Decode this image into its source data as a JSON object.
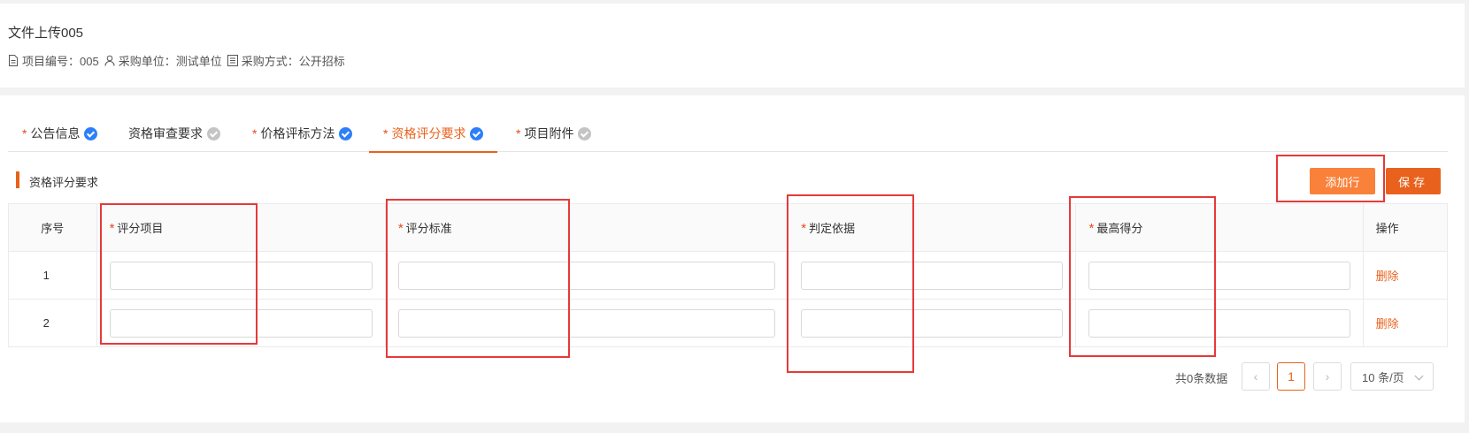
{
  "project": {
    "title": "文件上传005",
    "meta": {
      "code_label": "项目编号：005",
      "unit_label": "采购单位：测试单位",
      "method_label": "采购方式：公开招标"
    }
  },
  "tabs": [
    {
      "label": "公告信息",
      "required": "*",
      "status": "done",
      "active": false
    },
    {
      "label": "资格审查要求",
      "required": "",
      "status": "todo",
      "active": false
    },
    {
      "label": "价格评标方法",
      "required": "*",
      "status": "done",
      "active": false
    },
    {
      "label": "资格评分要求",
      "required": "*",
      "status": "done",
      "active": true
    },
    {
      "label": "项目附件",
      "required": "*",
      "status": "todo",
      "active": false
    }
  ],
  "section": {
    "title": "资格评分要求"
  },
  "toolbar": {
    "add_label": "添加行",
    "save_label": "保存"
  },
  "table": {
    "columns": [
      {
        "label": "序号",
        "required": ""
      },
      {
        "label": "评分项目",
        "required": "*"
      },
      {
        "label": "评分标准",
        "required": "*"
      },
      {
        "label": "判定依据",
        "required": "*"
      },
      {
        "label": "最高得分",
        "required": "*"
      },
      {
        "label": "操作",
        "required": ""
      }
    ],
    "rows": [
      {
        "index": "1",
        "item": "",
        "standard": "",
        "basis": "",
        "max_score": "",
        "action": "删除"
      },
      {
        "index": "2",
        "item": "",
        "standard": "",
        "basis": "",
        "max_score": "",
        "action": "删除"
      }
    ]
  },
  "pagination": {
    "total_label": "共0条数据",
    "prev": "‹",
    "current_page": "1",
    "next": "›",
    "page_size_label": "10 条/页"
  },
  "colors": {
    "accent": "#e8621d",
    "check_done": "#2d7ff9",
    "highlight": "#e63939"
  }
}
